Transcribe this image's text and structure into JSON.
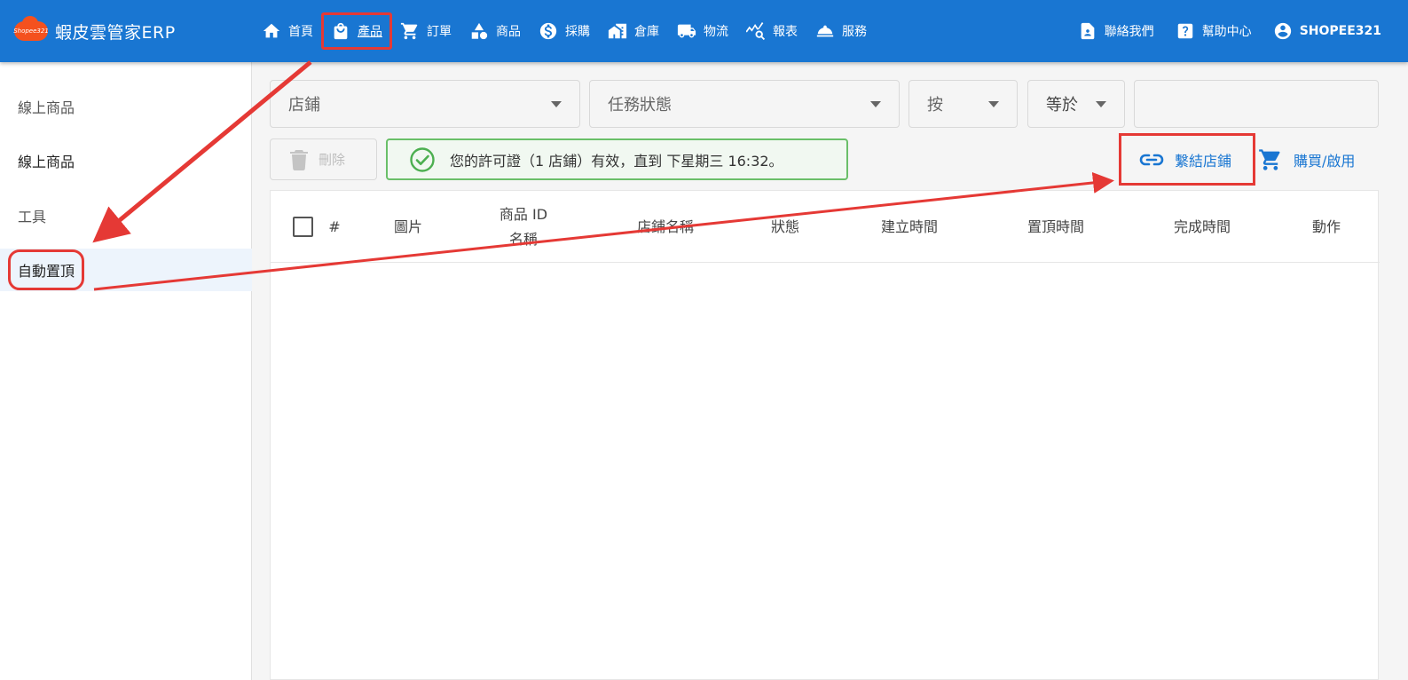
{
  "app": {
    "logo_text": "Shopee321",
    "title": "蝦皮雲管家ERP"
  },
  "nav": [
    {
      "label": "首頁",
      "icon": "home-icon"
    },
    {
      "label": "產品",
      "icon": "shopping-bag-icon",
      "active": true
    },
    {
      "label": "訂單",
      "icon": "cart-icon"
    },
    {
      "label": "商品",
      "icon": "shapes-icon"
    },
    {
      "label": "採購",
      "icon": "dollar-icon"
    },
    {
      "label": "倉庫",
      "icon": "warehouse-icon"
    },
    {
      "label": "物流",
      "icon": "truck-icon"
    },
    {
      "label": "報表",
      "icon": "chart-search-icon"
    },
    {
      "label": "服務",
      "icon": "service-bell-icon"
    }
  ],
  "nav_right": {
    "contact": "聯絡我們",
    "help": "幫助中心",
    "user": "SHOPEE321"
  },
  "sidebar": {
    "items": [
      {
        "label": "線上商品"
      },
      {
        "label": "線上商品"
      },
      {
        "label": "工具"
      },
      {
        "label": "自動置頂",
        "active": true
      }
    ]
  },
  "filters": {
    "shop": "店鋪",
    "task_status": "任務狀態",
    "by": "按",
    "operator": "等於",
    "search_value": ""
  },
  "toolbar": {
    "delete": "刪除",
    "license": "您的許可證（1 店鋪）有效，直到 下星期三 16:32。",
    "link_shop": "繫結店鋪",
    "buy": "購買/啟用"
  },
  "table": {
    "columns": {
      "index": "#",
      "image": "圖片",
      "product_id": "商品 ID",
      "product_name": "名稱",
      "shop_name": "店鋪名稱",
      "status": "狀態",
      "created": "建立時間",
      "pinned": "置頂時間",
      "completed": "完成時間",
      "action": "動作"
    },
    "rows": []
  },
  "colors": {
    "primary": "#1976d2",
    "annotation": "#e53935",
    "license_border": "#6abf69"
  }
}
